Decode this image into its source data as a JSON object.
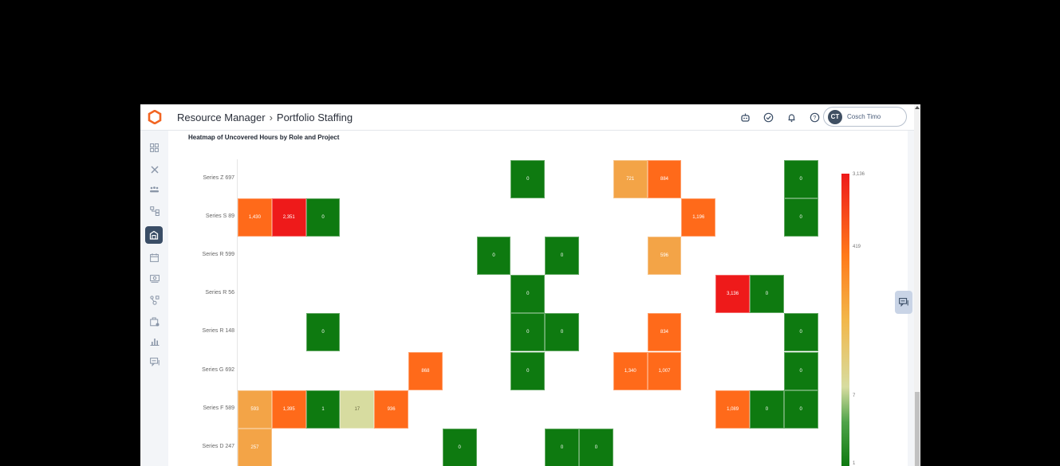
{
  "header": {
    "breadcrumb_root": "Resource Manager",
    "breadcrumb_sep": "›",
    "breadcrumb_current": "Portfolio Staffing",
    "icons": [
      "bot-icon",
      "check-circle-icon",
      "notification-bell-icon",
      "help-icon"
    ],
    "user": {
      "initials": "CT",
      "name": "Cosch Timo"
    }
  },
  "sidebar": {
    "items": [
      "dashboard-icon",
      "tools-icon",
      "team-icon",
      "hierarchy-icon",
      "portfolio-icon",
      "calendar-icon",
      "money-icon",
      "workflow-icon",
      "briefcase-icon",
      "bar-chart-icon",
      "chat-icon"
    ],
    "active_index": 4
  },
  "chart_title": "Heatmap of Uncovered Hours by Role and Project",
  "colors": {
    "max": "#ee1a1a",
    "high": "#ff6a1a",
    "mid": "#f3a447",
    "low": "#d7dca0",
    "zero": "#0e7a10"
  },
  "chart_data": {
    "type": "heatmap",
    "title": "Heatmap of Uncovered Hours by Role and Project",
    "rows": [
      "Series Z 697",
      "Series S 89",
      "Series R 599",
      "Series R 56",
      "Series R 148",
      "Series G 692",
      "Series F 589",
      "Series D 247"
    ],
    "column_count": 17,
    "cells": [
      {
        "row": 0,
        "col": 8,
        "value": 0,
        "label": "0"
      },
      {
        "row": 0,
        "col": 11,
        "value": 721,
        "label": "721"
      },
      {
        "row": 0,
        "col": 12,
        "value": 884,
        "label": "884"
      },
      {
        "row": 0,
        "col": 16,
        "value": 0,
        "label": "0"
      },
      {
        "row": 1,
        "col": 0,
        "value": 1430,
        "label": "1,430"
      },
      {
        "row": 1,
        "col": 1,
        "value": 2351,
        "label": "2,351"
      },
      {
        "row": 1,
        "col": 2,
        "value": 0,
        "label": "0"
      },
      {
        "row": 1,
        "col": 13,
        "value": 1196,
        "label": "1,196"
      },
      {
        "row": 1,
        "col": 16,
        "value": 0,
        "label": "0"
      },
      {
        "row": 2,
        "col": 7,
        "value": 0,
        "label": "0"
      },
      {
        "row": 2,
        "col": 9,
        "value": 0,
        "label": "0"
      },
      {
        "row": 2,
        "col": 12,
        "value": 596,
        "label": "596"
      },
      {
        "row": 3,
        "col": 8,
        "value": 0,
        "label": "0"
      },
      {
        "row": 3,
        "col": 14,
        "value": 3136,
        "label": "3,136"
      },
      {
        "row": 3,
        "col": 15,
        "value": 0,
        "label": "0"
      },
      {
        "row": 4,
        "col": 2,
        "value": 0,
        "label": "0"
      },
      {
        "row": 4,
        "col": 8,
        "value": 0,
        "label": "0"
      },
      {
        "row": 4,
        "col": 9,
        "value": 0,
        "label": "0"
      },
      {
        "row": 4,
        "col": 12,
        "value": 834,
        "label": "834"
      },
      {
        "row": 4,
        "col": 16,
        "value": 0,
        "label": "0"
      },
      {
        "row": 5,
        "col": 5,
        "value": 868,
        "label": "868"
      },
      {
        "row": 5,
        "col": 8,
        "value": 0,
        "label": "0"
      },
      {
        "row": 5,
        "col": 11,
        "value": 1340,
        "label": "1,340"
      },
      {
        "row": 5,
        "col": 12,
        "value": 1007,
        "label": "1,007"
      },
      {
        "row": 5,
        "col": 16,
        "value": 0,
        "label": "0"
      },
      {
        "row": 6,
        "col": 0,
        "value": 593,
        "label": "593"
      },
      {
        "row": 6,
        "col": 1,
        "value": 1395,
        "label": "1,395"
      },
      {
        "row": 6,
        "col": 2,
        "value": 1,
        "label": "1"
      },
      {
        "row": 6,
        "col": 3,
        "value": 17,
        "label": "17"
      },
      {
        "row": 6,
        "col": 4,
        "value": 936,
        "label": "936"
      },
      {
        "row": 6,
        "col": 14,
        "value": 1089,
        "label": "1,089"
      },
      {
        "row": 6,
        "col": 15,
        "value": 0,
        "label": "0"
      },
      {
        "row": 6,
        "col": 16,
        "value": 0,
        "label": "0"
      },
      {
        "row": 7,
        "col": 0,
        "value": 257,
        "label": "257"
      },
      {
        "row": 7,
        "col": 6,
        "value": 0,
        "label": "0"
      },
      {
        "row": 7,
        "col": 9,
        "value": 0,
        "label": "0"
      },
      {
        "row": 7,
        "col": 10,
        "value": 0,
        "label": "0"
      }
    ],
    "color_scale": {
      "type": "log",
      "min": 0,
      "max": 3136,
      "tick_labels": [
        "3,136",
        "419",
        "7",
        "1"
      ]
    }
  }
}
